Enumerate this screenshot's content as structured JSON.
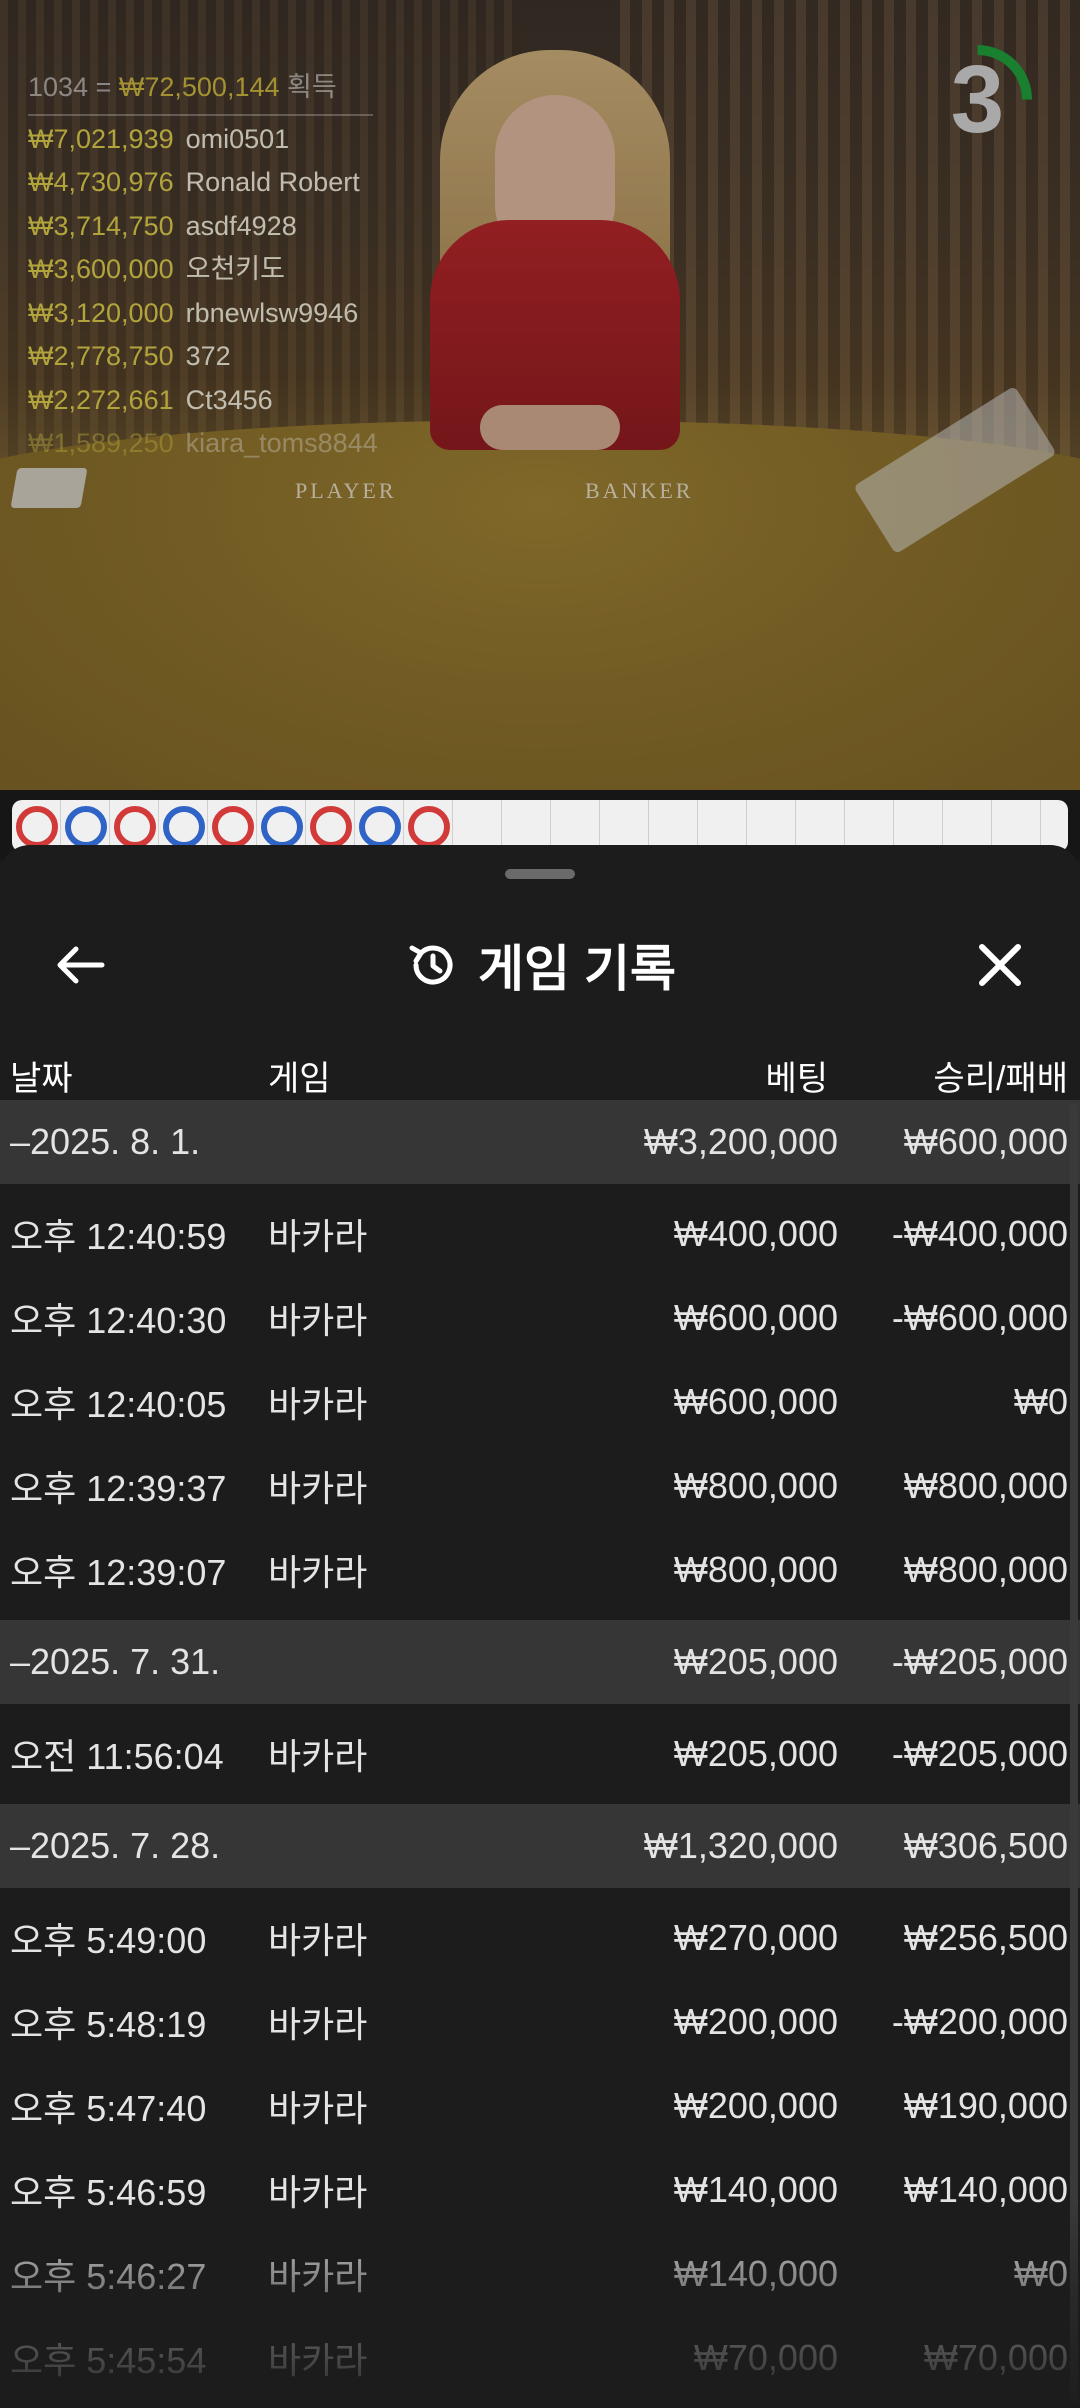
{
  "stream": {
    "table_labels": {
      "player": "PLAYER",
      "banker": "BANKER"
    },
    "countdown": "3",
    "winners_total": {
      "count": "1034",
      "amount": "₩72,500,144",
      "suffix": "획득"
    },
    "winners": [
      {
        "amount": "₩7,021,939",
        "name": "omi0501"
      },
      {
        "amount": "₩4,730,976",
        "name": "Ronald Robert"
      },
      {
        "amount": "₩3,714,750",
        "name": "asdf4928"
      },
      {
        "amount": "₩3,600,000",
        "name": "오천키도"
      },
      {
        "amount": "₩3,120,000",
        "name": "rbnewlsw9946"
      },
      {
        "amount": "₩2,778,750",
        "name": "372"
      },
      {
        "amount": "₩2,272,661",
        "name": "Ct3456"
      },
      {
        "amount": "₩1,589,250",
        "name": "kiara_toms8844"
      }
    ],
    "road_beads": [
      "red",
      "blue",
      "red",
      "blue",
      "red",
      "blue",
      "red",
      "blue",
      "red"
    ],
    "colors": {
      "player": "#2f63c6",
      "banker": "#d23a3a",
      "countdown_ring": "#1f9d3a"
    }
  },
  "sheet": {
    "title": "게임 기록",
    "icons": {
      "back": "arrow-left-icon",
      "title": "history-icon",
      "close": "close-icon"
    },
    "columns": {
      "date": "날짜",
      "game": "게임",
      "bet": "베팅",
      "result": "승리/패배"
    },
    "rows": [
      {
        "type": "group",
        "date": "–2025. 8. 1.",
        "bet": "₩3,200,000",
        "result": "₩600,000"
      },
      {
        "type": "entry",
        "date": "오후 12:40:59",
        "game": "바카라",
        "bet": "₩400,000",
        "result": "-₩400,000"
      },
      {
        "type": "entry",
        "date": "오후 12:40:30",
        "game": "바카라",
        "bet": "₩600,000",
        "result": "-₩600,000"
      },
      {
        "type": "entry",
        "date": "오후 12:40:05",
        "game": "바카라",
        "bet": "₩600,000",
        "result": "₩0"
      },
      {
        "type": "entry",
        "date": "오후 12:39:37",
        "game": "바카라",
        "bet": "₩800,000",
        "result": "₩800,000"
      },
      {
        "type": "entry",
        "date": "오후 12:39:07",
        "game": "바카라",
        "bet": "₩800,000",
        "result": "₩800,000"
      },
      {
        "type": "group",
        "date": "–2025. 7. 31.",
        "bet": "₩205,000",
        "result": "-₩205,000"
      },
      {
        "type": "entry",
        "date": "오전 11:56:04",
        "game": "바카라",
        "bet": "₩205,000",
        "result": "-₩205,000"
      },
      {
        "type": "group",
        "date": "–2025. 7. 28.",
        "bet": "₩1,320,000",
        "result": "₩306,500"
      },
      {
        "type": "entry",
        "date": "오후 5:49:00",
        "game": "바카라",
        "bet": "₩270,000",
        "result": "₩256,500"
      },
      {
        "type": "entry",
        "date": "오후 5:48:19",
        "game": "바카라",
        "bet": "₩200,000",
        "result": "-₩200,000"
      },
      {
        "type": "entry",
        "date": "오후 5:47:40",
        "game": "바카라",
        "bet": "₩200,000",
        "result": "₩190,000"
      },
      {
        "type": "entry",
        "date": "오후 5:46:59",
        "game": "바카라",
        "bet": "₩140,000",
        "result": "₩140,000"
      },
      {
        "type": "entry",
        "date": "오후 5:46:27",
        "game": "바카라",
        "bet": "₩140,000",
        "result": "₩0"
      },
      {
        "type": "entry",
        "date": "오후 5:45:54",
        "game": "바카라",
        "bet": "₩70,000",
        "result": "₩70,000"
      }
    ]
  }
}
